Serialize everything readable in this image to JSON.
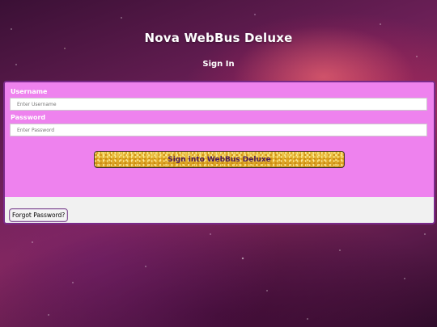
{
  "header": {
    "app_title": "Nova WebBus Deluxe",
    "subtitle": "Sign In"
  },
  "form": {
    "username_label": "Username",
    "username_placeholder": "Enter Username",
    "username_value": "",
    "password_label": "Password",
    "password_placeholder": "Enter Password",
    "password_value": "",
    "signin_label": "Sign into WebBus Deluxe"
  },
  "footer": {
    "forgot_label": "Forgot Password?"
  },
  "colors": {
    "form_background": "#ee82ee",
    "panel_border": "#7a2a8a",
    "button_gold": "#e6b833",
    "button_text": "#4a1a5a"
  }
}
